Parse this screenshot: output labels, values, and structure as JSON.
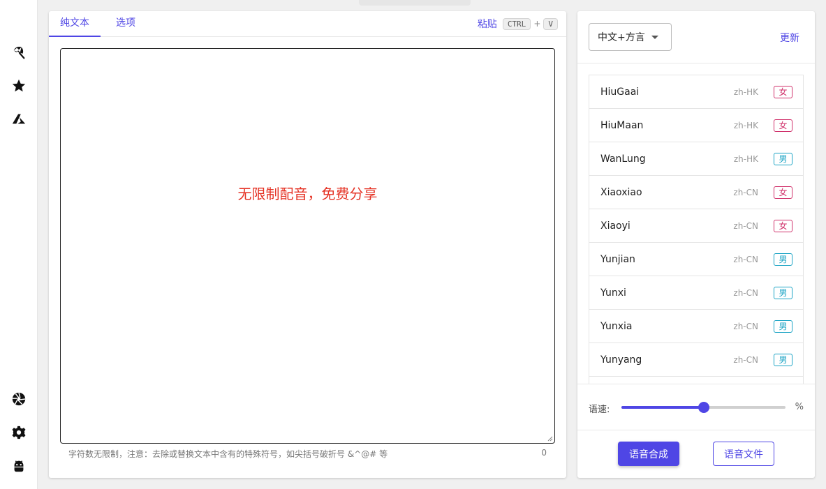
{
  "sidebar": {
    "top_icons": [
      "umbrella-icon",
      "star-icon",
      "azure-icon"
    ],
    "bottom_icons": [
      "aperture-icon",
      "settings-icon",
      "android-icon"
    ]
  },
  "editor": {
    "tabs": [
      {
        "label": "纯文本",
        "active": true
      },
      {
        "label": "选项",
        "active": false
      }
    ],
    "paste": {
      "label": "粘贴",
      "key1": "CTRL",
      "plus": "+",
      "key2": "V"
    },
    "text_content": "无限制配音，免费分享",
    "hint": "字符数无限制，注意：去除或替换文本中含有的特殊符号，如尖括号破折号 &^@# 等",
    "char_count": "0",
    "text_color": "#e53224"
  },
  "voice_panel": {
    "language_select": "中文+方言",
    "refresh_label": "更新",
    "voices": [
      {
        "name": "HiuGaai",
        "locale": "zh-HK",
        "gender": "女",
        "g": "f"
      },
      {
        "name": "HiuMaan",
        "locale": "zh-HK",
        "gender": "女",
        "g": "f"
      },
      {
        "name": "WanLung",
        "locale": "zh-HK",
        "gender": "男",
        "g": "m"
      },
      {
        "name": "Xiaoxiao",
        "locale": "zh-CN",
        "gender": "女",
        "g": "f"
      },
      {
        "name": "Xiaoyi",
        "locale": "zh-CN",
        "gender": "女",
        "g": "f"
      },
      {
        "name": "Yunjian",
        "locale": "zh-CN",
        "gender": "男",
        "g": "m"
      },
      {
        "name": "Yunxi",
        "locale": "zh-CN",
        "gender": "男",
        "g": "m"
      },
      {
        "name": "Yunxia",
        "locale": "zh-CN",
        "gender": "男",
        "g": "m"
      },
      {
        "name": "Yunyang",
        "locale": "zh-CN",
        "gender": "男",
        "g": "m"
      }
    ],
    "speed_label": "语速:",
    "speed_unit": "%",
    "speed_fraction": 0.5,
    "synthesize_label": "语音合成",
    "file_label": "语音文件"
  },
  "colors": {
    "accent": "#4f46e5",
    "female": "#d0306a",
    "male": "#1aa3c4"
  }
}
